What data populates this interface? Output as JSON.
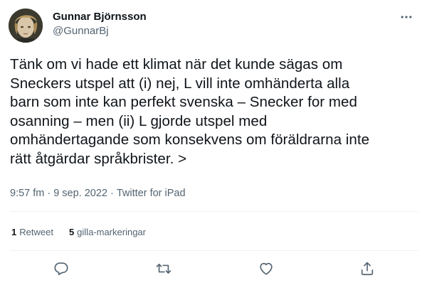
{
  "author": {
    "display_name": "Gunnar Björnsson",
    "handle": "@GunnarBj"
  },
  "tweet": {
    "text": "Tänk om vi hade ett klimat när det kunde sägas om\nSneckers utspel att (i) nej, L vill inte omhänderta alla\nbarn som inte kan perfekt svenska – Snecker for med\nosanning – men (ii) L gjorde utspel med\nomhändertagande som konsekvens om föräldrarna inte\nrätt åtgärdar språkbrister. >",
    "time": "9:57 fm",
    "date": "9 sep. 2022",
    "source": "Twitter for iPad",
    "separator": "·"
  },
  "stats": {
    "retweets_count": "1",
    "retweets_label": "Retweet",
    "likes_count": "5",
    "likes_label": "gilla-markeringar"
  },
  "icons": {
    "more": "more-horizontal-icon",
    "reply": "reply-bubble-icon",
    "retweet": "retweet-icon",
    "like": "heart-icon",
    "share": "share-upload-icon"
  },
  "colors": {
    "text": "#0f1419",
    "secondary": "#536471",
    "divider": "#eff3f4"
  }
}
